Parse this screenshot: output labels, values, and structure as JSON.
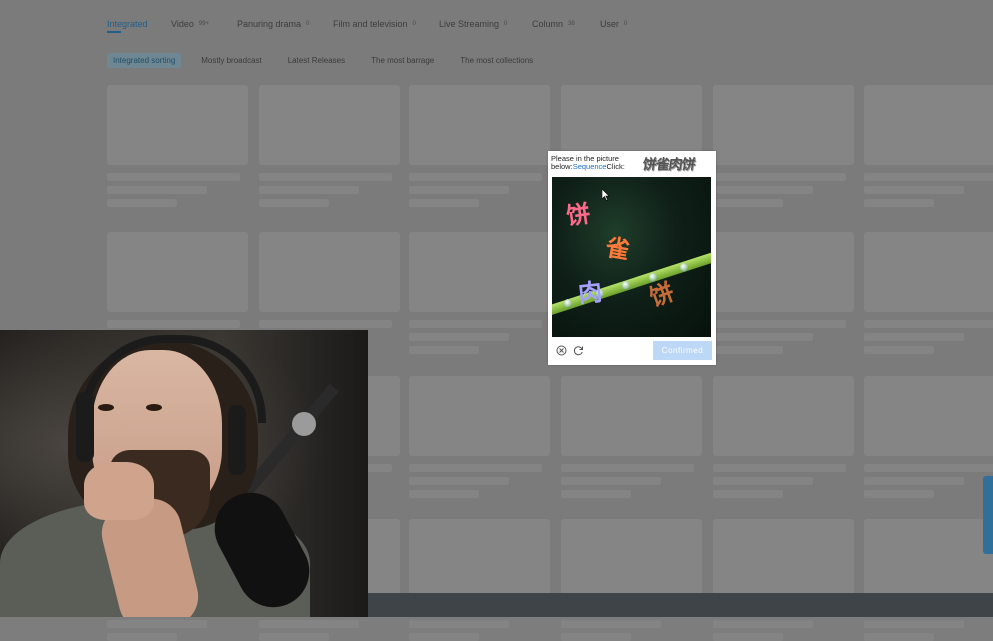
{
  "nav": {
    "tabs": [
      {
        "label": "Integrated",
        "count": "",
        "active": true
      },
      {
        "label": "Video",
        "count": "99+",
        "active": false
      },
      {
        "label": "Panuring drama",
        "count": "0",
        "active": false
      },
      {
        "label": "Film and television",
        "count": "0",
        "active": false
      },
      {
        "label": "Live Streaming",
        "count": "0",
        "active": false
      },
      {
        "label": "Column",
        "count": "36",
        "active": false
      },
      {
        "label": "User",
        "count": "0",
        "active": false
      }
    ]
  },
  "subnav": {
    "chips": [
      "Integrated sorting",
      "Mostly broadcast",
      "Latest Releases",
      "The most barrage",
      "The most collections"
    ]
  },
  "captcha": {
    "prompt_before": "Please in the picture below:",
    "prompt_highlight": "Sequence",
    "prompt_after": "Click:",
    "target_chars": "饼雀肉饼",
    "picture_chars": [
      {
        "char": "饼",
        "color": "#ff6a8a"
      },
      {
        "char": "雀",
        "color": "#ff7a3a"
      },
      {
        "char": "肉",
        "color": "#a5a0ff"
      },
      {
        "char": "饼",
        "color": "#c66b3a"
      }
    ],
    "confirm_label": "Confirmed",
    "close_icon": "close-circle-icon",
    "refresh_icon": "refresh-icon"
  }
}
